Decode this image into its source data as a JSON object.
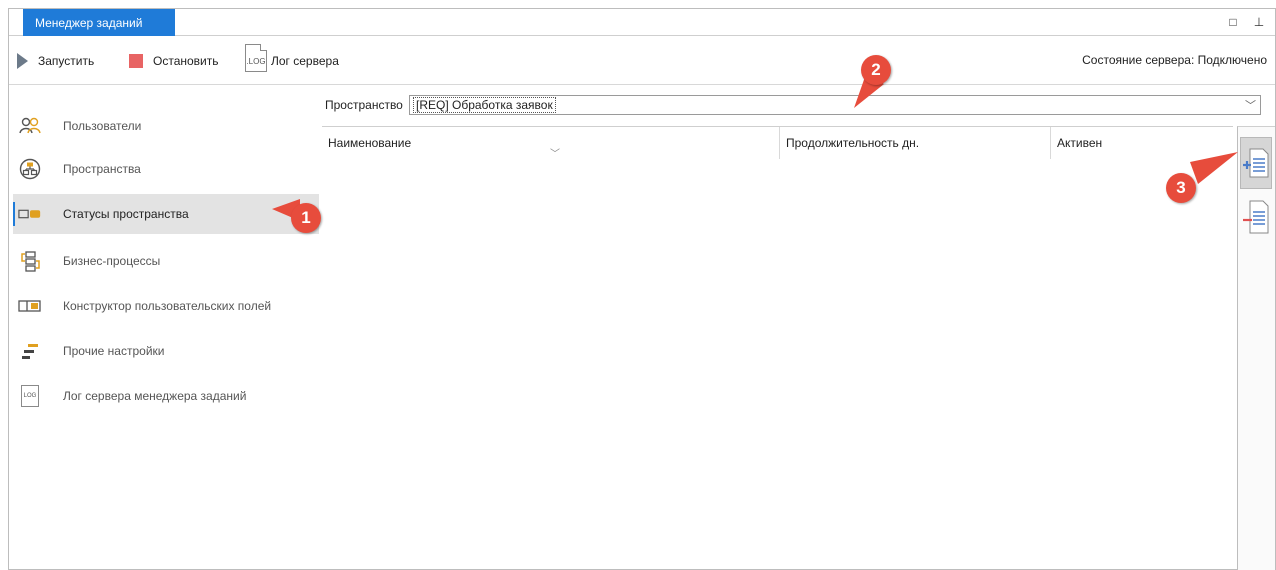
{
  "tab": {
    "title": "Менеджер заданий"
  },
  "window_controls": {
    "restore": "□",
    "pin": "⊥"
  },
  "toolbar": {
    "start_label": "Запустить",
    "stop_label": "Остановить",
    "log_icon_text": ".LOG",
    "log_label": "Лог сервера",
    "server_status": "Состояние сервера: Подключено"
  },
  "sidebar": {
    "items": [
      {
        "label": "Пользователи",
        "icon": "users-icon"
      },
      {
        "label": "Пространства",
        "icon": "spaces-icon"
      },
      {
        "label": "Статусы пространства",
        "icon": "statuses-icon"
      },
      {
        "label": "Бизнес-процессы",
        "icon": "business-process-icon"
      },
      {
        "label": "Конструктор пользовательских полей",
        "icon": "field-constructor-icon"
      },
      {
        "label": "Прочие настройки",
        "icon": "settings-icon"
      },
      {
        "label": "Лог сервера менеджера заданий",
        "icon": "log-icon"
      }
    ],
    "active_index": 2,
    "log_icon_text": "LOG"
  },
  "space": {
    "label": "Пространство",
    "value": "[REQ] Обработка заявок"
  },
  "grid": {
    "columns": [
      "Наименование",
      "Продолжительность дн.",
      "Активен"
    ]
  },
  "callouts": [
    "1",
    "2",
    "3"
  ],
  "colors": {
    "accent": "#1f7bd8",
    "stop": "#e86464",
    "callout": "#e74c3c"
  }
}
